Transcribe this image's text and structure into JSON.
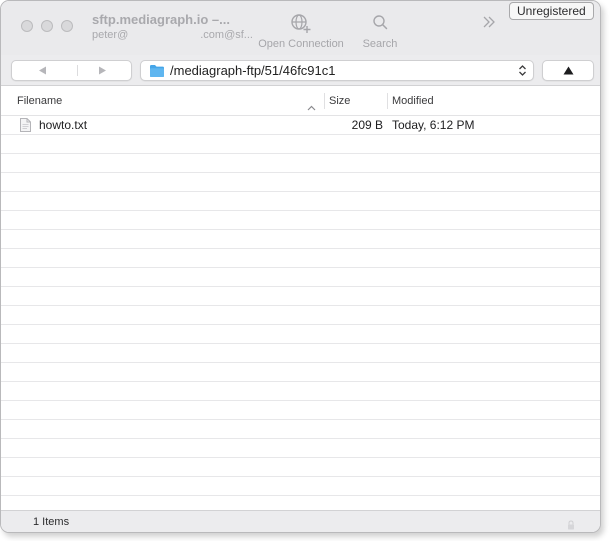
{
  "window": {
    "title": "sftp.mediagraph.io –...",
    "subtitle_prefix": "peter@",
    "subtitle_suffix": ".com@sf..."
  },
  "toolbar": {
    "open_connection_label": "Open Connection",
    "search_label": "Search",
    "unregistered_label": "Unregistered"
  },
  "pathbar": {
    "path": "/mediagraph-ftp/51/46fc91c1",
    "back_icon": "triangle-left",
    "forward_icon": "triangle-right",
    "up_icon": "triangle-up",
    "folder_color": "#45a5e8"
  },
  "columns": {
    "filename": "Filename",
    "size": "Size",
    "modified": "Modified"
  },
  "files": [
    {
      "name": "howto.txt",
      "size": "209 B",
      "modified": "Today, 6:12 PM"
    }
  ],
  "status": {
    "item_count": "1 Items"
  }
}
